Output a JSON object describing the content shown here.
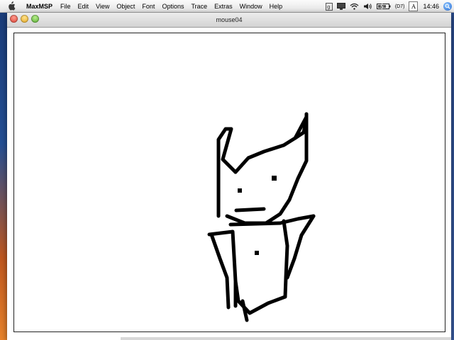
{
  "menubar": {
    "app_name": "MaxMSP",
    "items": [
      "File",
      "Edit",
      "View",
      "Object",
      "Font",
      "Options",
      "Trace",
      "Extras",
      "Window",
      "Help"
    ],
    "battery": "(D7)",
    "input_menu": "A",
    "clock": "14:46"
  },
  "window": {
    "title": "mouse04"
  },
  "colors": {
    "stroke": "#000000",
    "canvas_bg": "#ffffff"
  }
}
